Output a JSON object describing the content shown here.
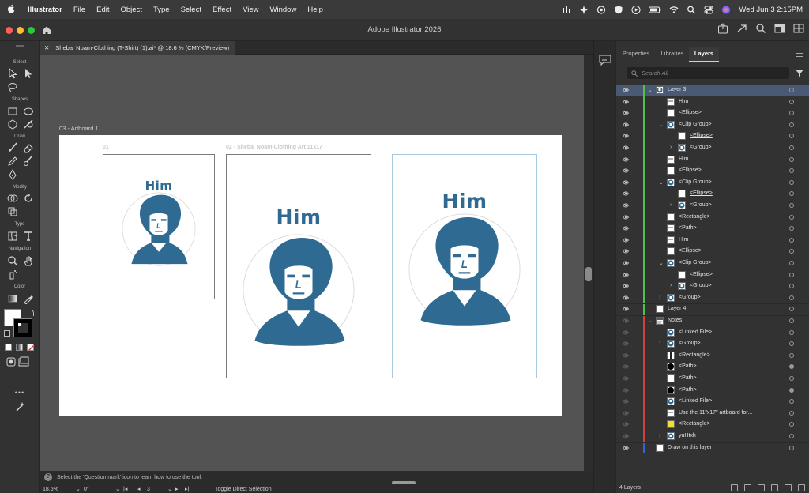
{
  "menubar": {
    "apple_icon": "apple-icon",
    "items": [
      {
        "label": "Illustrator",
        "app": true
      },
      {
        "label": "File"
      },
      {
        "label": "Edit"
      },
      {
        "label": "Object"
      },
      {
        "label": "Type"
      },
      {
        "label": "Select"
      },
      {
        "label": "Effect"
      },
      {
        "label": "View"
      },
      {
        "label": "Window"
      },
      {
        "label": "Help"
      }
    ],
    "clock": "Wed Jun 3  2:15PM"
  },
  "titlebar": {
    "title": "Adobe Illustrator 2026"
  },
  "document": {
    "tab_label": "Sheba_Noam-Clothing (T-Shirt) (1).ai* @ 18.6 % (CMYK/Preview)",
    "close_glyph": "✕",
    "collapse_glyph": "»"
  },
  "toolbar": {
    "sections": [
      "Select",
      "Shapes",
      "Draw",
      "Modify",
      "Type",
      "Navigation",
      "Color"
    ],
    "more_glyph": "•••"
  },
  "canvas": {
    "artboard_label": "03 - Artboard 1",
    "sub_labels": [
      "01",
      "02 - Sheba_Noam-Clothing Art 11x17"
    ],
    "portrait_text": "Him",
    "portrait_color": "#2f6a92",
    "canvas_color": "#535353"
  },
  "status": {
    "hint": "Select the 'Question mark' icon to learn how to use the tool.",
    "hint_icon": "?",
    "zoom": "18.6%",
    "rotation": "0°",
    "artboard_number": "3",
    "toggle_label": "Toggle Direct Selection"
  },
  "panel": {
    "tabs": [
      "Properties",
      "Libraries",
      "Layers"
    ],
    "active_tab": "Layers",
    "search_placeholder": "Search All",
    "footer": "4 Layers",
    "layers": [
      {
        "name": "Layer 3",
        "indent": 0,
        "arrow": "open",
        "color": "#4fc14f",
        "thumb": "photo",
        "selected": true,
        "visible": true
      },
      {
        "name": "Him",
        "indent": 1,
        "arrow": "",
        "color": "#4fc14f",
        "thumb": "text",
        "visible": true
      },
      {
        "name": "<Ellipse>",
        "indent": 1,
        "arrow": "",
        "color": "#4fc14f",
        "thumb": "white",
        "visible": true
      },
      {
        "name": "<Clip Group>",
        "indent": 1,
        "arrow": "open",
        "color": "#4fc14f",
        "thumb": "photo",
        "visible": true
      },
      {
        "name": "<Ellipse>",
        "indent": 2,
        "arrow": "",
        "color": "#4fc14f",
        "thumb": "white",
        "underline": true,
        "visible": true
      },
      {
        "name": "<Group>",
        "indent": 2,
        "arrow": "closed",
        "color": "#4fc14f",
        "thumb": "photo",
        "visible": true
      },
      {
        "name": "Him",
        "indent": 1,
        "arrow": "",
        "color": "#4fc14f",
        "thumb": "text",
        "visible": true
      },
      {
        "name": "<Ellipse>",
        "indent": 1,
        "arrow": "",
        "color": "#4fc14f",
        "thumb": "white",
        "visible": true
      },
      {
        "name": "<Clip Group>",
        "indent": 1,
        "arrow": "open",
        "color": "#4fc14f",
        "thumb": "photo",
        "visible": true
      },
      {
        "name": "<Ellipse>",
        "indent": 2,
        "arrow": "",
        "color": "#4fc14f",
        "thumb": "white",
        "underline": true,
        "visible": true
      },
      {
        "name": "<Group>",
        "indent": 2,
        "arrow": "closed",
        "color": "#4fc14f",
        "thumb": "photo",
        "visible": true
      },
      {
        "name": "<Rectangle>",
        "indent": 1,
        "arrow": "",
        "color": "#4fc14f",
        "thumb": "white",
        "visible": true
      },
      {
        "name": "<Path>",
        "indent": 1,
        "arrow": "",
        "color": "#4fc14f",
        "thumb": "text",
        "visible": true
      },
      {
        "name": "Him",
        "indent": 1,
        "arrow": "",
        "color": "#4fc14f",
        "thumb": "text",
        "visible": true
      },
      {
        "name": "<Ellipse>",
        "indent": 1,
        "arrow": "",
        "color": "#4fc14f",
        "thumb": "white",
        "visible": true
      },
      {
        "name": "<Clip Group>",
        "indent": 1,
        "arrow": "open",
        "color": "#4fc14f",
        "thumb": "photo",
        "visible": true
      },
      {
        "name": "<Ellipse>",
        "indent": 2,
        "arrow": "",
        "color": "#4fc14f",
        "thumb": "white",
        "underline": true,
        "visible": true
      },
      {
        "name": "<Group>",
        "indent": 2,
        "arrow": "closed",
        "color": "#4fc14f",
        "thumb": "photo",
        "visible": true
      },
      {
        "name": "<Group>",
        "indent": 1,
        "arrow": "closed",
        "color": "#4fc14f",
        "thumb": "photo",
        "visible": true
      },
      {
        "name": "Layer 4",
        "indent": 0,
        "arrow": "",
        "color": "#4fc14f",
        "thumb": "white",
        "visible": true
      },
      {
        "name": "Notes",
        "indent": 0,
        "arrow": "open",
        "color": "#d04040",
        "thumb": "notes",
        "visible": false
      },
      {
        "name": "<Linked File>",
        "indent": 1,
        "arrow": "",
        "color": "#d04040",
        "thumb": "photo",
        "visible": false
      },
      {
        "name": "<Group>",
        "indent": 1,
        "arrow": "closed",
        "color": "#d04040",
        "thumb": "photo",
        "visible": false
      },
      {
        "name": "<Rectangle>",
        "indent": 1,
        "arrow": "",
        "color": "#d04040",
        "thumb": "bar",
        "visible": false
      },
      {
        "name": "<Path>",
        "indent": 1,
        "arrow": "",
        "color": "#d04040",
        "thumb": "black",
        "visible": false,
        "filled": true
      },
      {
        "name": "<Path>",
        "indent": 1,
        "arrow": "",
        "color": "#d04040",
        "thumb": "white",
        "visible": false
      },
      {
        "name": "<Path>",
        "indent": 1,
        "arrow": "",
        "color": "#d04040",
        "thumb": "black",
        "visible": false,
        "filled": true
      },
      {
        "name": "<Linked File>",
        "indent": 1,
        "arrow": "",
        "color": "#d04040",
        "thumb": "photo",
        "visible": false
      },
      {
        "name": "Use the 11\"x17\" artboard  for...",
        "indent": 1,
        "arrow": "",
        "color": "#d04040",
        "thumb": "text",
        "visible": false
      },
      {
        "name": "<Rectangle>",
        "indent": 1,
        "arrow": "",
        "color": "#d04040",
        "thumb": "yellow",
        "visible": false
      },
      {
        "name": "yuHtxh",
        "indent": 1,
        "arrow": "closed",
        "color": "#d04040",
        "thumb": "photo",
        "visible": false
      },
      {
        "name": "Draw on this layer",
        "indent": 0,
        "arrow": "",
        "color": "#3a62d8",
        "thumb": "white",
        "visible": true
      }
    ]
  }
}
